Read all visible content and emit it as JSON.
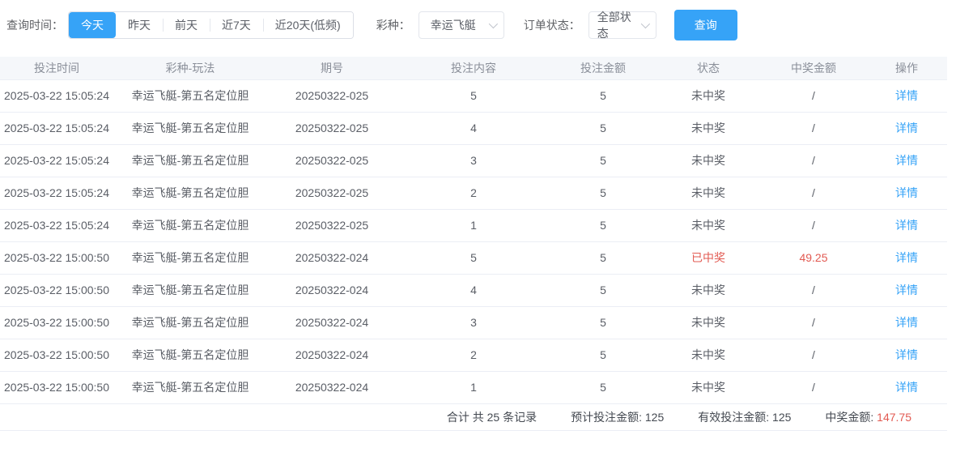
{
  "colors": {
    "primary": "#36a3f7",
    "danger": "#e25a52"
  },
  "filters": {
    "time_label": "查询时间：",
    "time_options": [
      {
        "label": "今天",
        "active": true
      },
      {
        "label": "昨天",
        "active": false
      },
      {
        "label": "前天",
        "active": false
      },
      {
        "label": "近7天",
        "active": false
      },
      {
        "label": "近20天(低频)",
        "active": false
      }
    ],
    "lottery_label": "彩种：",
    "lottery_value": "幸运飞艇",
    "status_label": "订单状态：",
    "status_value": "全部状态",
    "query_button": "查询"
  },
  "table": {
    "columns": [
      "投注时间",
      "彩种-玩法",
      "期号",
      "投注内容",
      "投注金额",
      "状态",
      "中奖金额",
      "操作"
    ],
    "rows": [
      {
        "time": "2025-03-22 15:05:24",
        "play": "幸运飞艇-第五名定位胆",
        "issue": "20250322-025",
        "content": "5",
        "amount": "5",
        "status": "未中奖",
        "won": false,
        "prize": "/",
        "action": "详情"
      },
      {
        "time": "2025-03-22 15:05:24",
        "play": "幸运飞艇-第五名定位胆",
        "issue": "20250322-025",
        "content": "4",
        "amount": "5",
        "status": "未中奖",
        "won": false,
        "prize": "/",
        "action": "详情"
      },
      {
        "time": "2025-03-22 15:05:24",
        "play": "幸运飞艇-第五名定位胆",
        "issue": "20250322-025",
        "content": "3",
        "amount": "5",
        "status": "未中奖",
        "won": false,
        "prize": "/",
        "action": "详情"
      },
      {
        "time": "2025-03-22 15:05:24",
        "play": "幸运飞艇-第五名定位胆",
        "issue": "20250322-025",
        "content": "2",
        "amount": "5",
        "status": "未中奖",
        "won": false,
        "prize": "/",
        "action": "详情"
      },
      {
        "time": "2025-03-22 15:05:24",
        "play": "幸运飞艇-第五名定位胆",
        "issue": "20250322-025",
        "content": "1",
        "amount": "5",
        "status": "未中奖",
        "won": false,
        "prize": "/",
        "action": "详情"
      },
      {
        "time": "2025-03-22 15:00:50",
        "play": "幸运飞艇-第五名定位胆",
        "issue": "20250322-024",
        "content": "5",
        "amount": "5",
        "status": "已中奖",
        "won": true,
        "prize": "49.25",
        "action": "详情"
      },
      {
        "time": "2025-03-22 15:00:50",
        "play": "幸运飞艇-第五名定位胆",
        "issue": "20250322-024",
        "content": "4",
        "amount": "5",
        "status": "未中奖",
        "won": false,
        "prize": "/",
        "action": "详情"
      },
      {
        "time": "2025-03-22 15:00:50",
        "play": "幸运飞艇-第五名定位胆",
        "issue": "20250322-024",
        "content": "3",
        "amount": "5",
        "status": "未中奖",
        "won": false,
        "prize": "/",
        "action": "详情"
      },
      {
        "time": "2025-03-22 15:00:50",
        "play": "幸运飞艇-第五名定位胆",
        "issue": "20250322-024",
        "content": "2",
        "amount": "5",
        "status": "未中奖",
        "won": false,
        "prize": "/",
        "action": "详情"
      },
      {
        "time": "2025-03-22 15:00:50",
        "play": "幸运飞艇-第五名定位胆",
        "issue": "20250322-024",
        "content": "1",
        "amount": "5",
        "status": "未中奖",
        "won": false,
        "prize": "/",
        "action": "详情"
      }
    ]
  },
  "summary": {
    "total_text": "合计 共 25 条记录",
    "expected_label": "预计投注金额:",
    "expected_value": "125",
    "valid_label": "有效投注金额:",
    "valid_value": "125",
    "prize_label": "中奖金额:",
    "prize_value": "147.75"
  }
}
